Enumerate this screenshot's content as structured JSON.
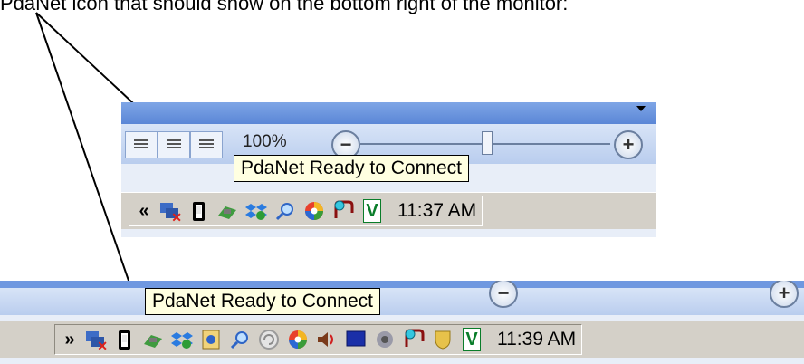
{
  "caption": "PdaNet icon that should show on the bottom right of the monitor:",
  "screenshot1": {
    "zoom_label": "100%",
    "tooltip": "PdaNet Ready to Connect",
    "tray_expand": "«",
    "clock": "11:37 AM",
    "icons": [
      "network-disconnected-icon",
      "pdanet-phone-icon",
      "usb-device-icon",
      "dropbox-icon",
      "search-icon",
      "sync-swirl-icon",
      "pointer-bubble-icon",
      "vc-icon"
    ]
  },
  "screenshot2": {
    "tooltip": "PdaNet Ready to Connect",
    "tray_expand": "»",
    "clock": "11:39 AM",
    "icons": [
      "network-disconnected-icon",
      "pdanet-phone-icon",
      "usb-device-icon",
      "dropbox-icon",
      "security-center-icon",
      "search-icon",
      "refresh-icon",
      "sync-swirl-icon",
      "volume-icon",
      "monitor-icon",
      "speaker-icon",
      "pointer-bubble-icon",
      "shield-icon",
      "vc-icon"
    ]
  },
  "colors": {
    "tooltip_bg": "#ffffe1",
    "taskbar_bg": "#d4d0c8",
    "arrow": "#000000",
    "toolband": "#5a86d6"
  },
  "vc_text": "V"
}
